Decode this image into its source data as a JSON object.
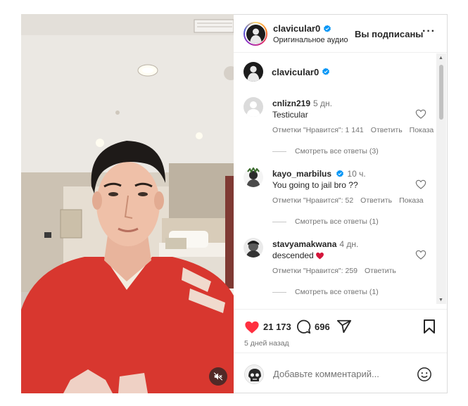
{
  "post": {
    "username": "clavicular0",
    "audio": "Оригинальное аудио",
    "follow_status": "Вы подписаны",
    "more": "···",
    "likes": "21 173",
    "comments": "696",
    "date": "5 дней назад",
    "comment_placeholder": "Добавьте комментарий..."
  },
  "owner": {
    "username": "clavicular0"
  },
  "comments": [
    {
      "username": "cnlizn219",
      "time": "5 дн.",
      "text": "Testicular",
      "likes": "Отметки \"Нравится\": 1 141",
      "reply": "Ответить",
      "translate": "Показа",
      "replies": "Смотреть все ответы (3)"
    },
    {
      "username": "kayo_marbilus",
      "time": "10 ч.",
      "text": "You going to jail bro ??",
      "likes": "Отметки \"Нравится\": 52",
      "reply": "Ответить",
      "translate": "Показа",
      "replies": "Смотреть все ответы (1)"
    },
    {
      "username": "stavyamakwana",
      "time": "4 дн.",
      "text": "descended",
      "likes": "Отметки \"Нравится\": 259",
      "reply": "Ответить",
      "translate": "",
      "replies": "Смотреть все ответы (1)"
    }
  ],
  "colors": {
    "like_red": "#ff3040",
    "verified_blue": "#0095f6",
    "secondary_text": "#737373",
    "shirt_red": "#d8372f"
  },
  "icons": [
    "verified-icon",
    "heart-icon",
    "comment-icon",
    "share-icon",
    "bookmark-icon",
    "emoji-icon",
    "mute-icon",
    "more-icon"
  ]
}
